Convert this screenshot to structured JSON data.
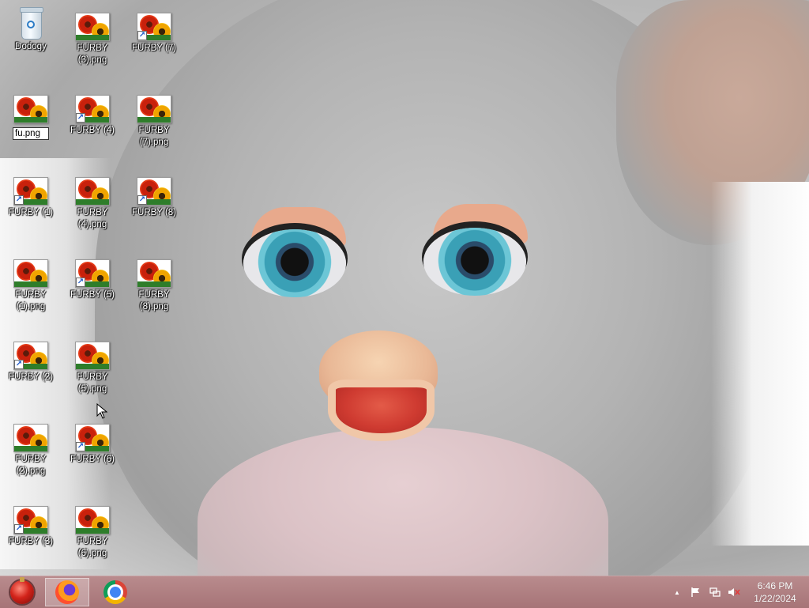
{
  "desktop": {
    "icons": {
      "recycle": "Dodogy",
      "furby3png": "FURBY (3).png",
      "furby7": "FURBY (7)",
      "rename_value": "fu.png",
      "furby4": "FURBY (4)",
      "furby7png": "FURBY (7).png",
      "furby1": "FURBY (1)",
      "furby4png": "FURBY (4).png",
      "furby8": "FURBY (8)",
      "furby1png": "FURBY (1).png",
      "furby5": "FURBY (5)",
      "furby8png": "FURBY (8).png",
      "furby2": "FURBY (2)",
      "furby5png": "FURBY (5).png",
      "furby2png": "FURBY (2).png",
      "furby6": "FURBY (6)",
      "furby3": "FURBY (3)",
      "furby6png": "FURBY (6).png"
    }
  },
  "taskbar": {
    "clock_time": "6:46 PM",
    "clock_date": "1/22/2024",
    "tray_chevron": "▲",
    "accent": "#a9797b"
  }
}
